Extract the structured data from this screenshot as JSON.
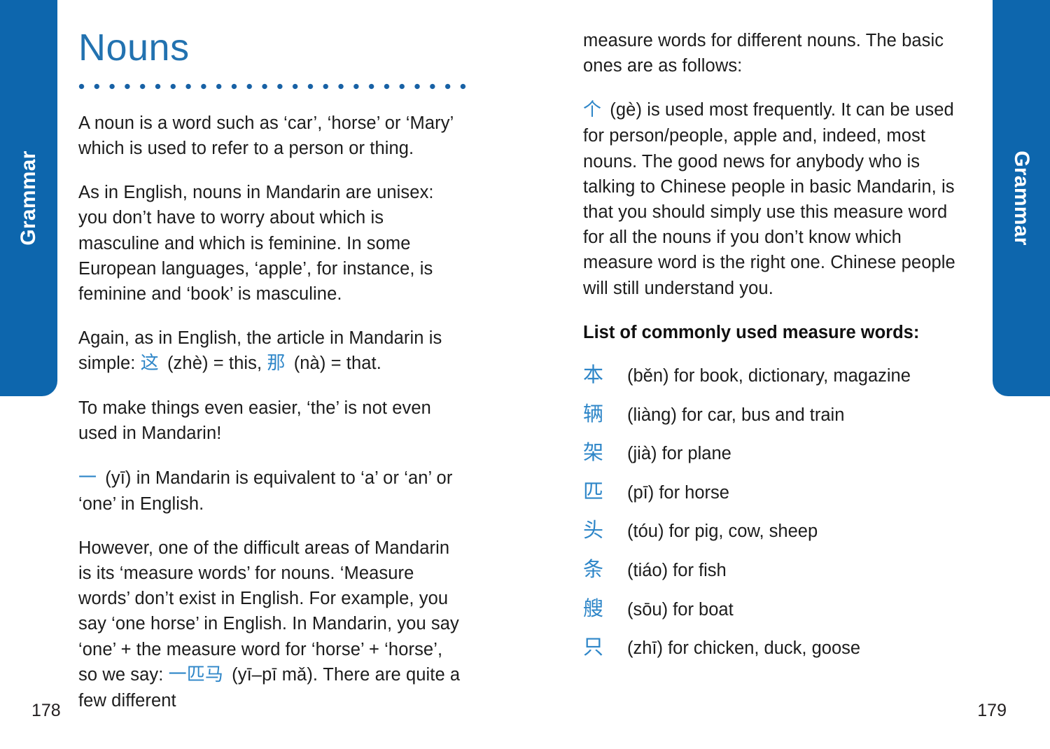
{
  "tabs": {
    "left_label": "Grammar",
    "right_label": "Grammar"
  },
  "colors": {
    "tab_blue": "#0d66ad",
    "heading_blue": "#2272b0",
    "hanzi_blue": "#2e86c8",
    "dot_blue": "#1761a5",
    "body_text": "#1c1c1c"
  },
  "left_page": {
    "heading": "Nouns",
    "folio": "178",
    "paragraphs": {
      "p1": "A noun is a word such as ‘car’, ‘horse’ or ‘Mary’ which is used to refer to a person or thing.",
      "p2": "As in English, nouns in Mandarin are unisex: you don’t have to worry about which is masculine and which is feminine. In some European languages, ‘apple’, for instance, is feminine and ‘book’ is masculine.",
      "p3_a": "Again, as in English, the article in Mandarin is simple:",
      "p3_hanzi_1": "这",
      "p3_b": "(zhè) = this,",
      "p3_hanzi_2": "那",
      "p3_c": "(nà) = that.",
      "p4": "To make things even easier, ‘the’ is not even used in Mandarin!",
      "p5_hanzi": "一",
      "p5_text": "(yī) in Mandarin is equivalent to ‘a’ or ‘an’ or ‘one’ in English.",
      "p6_a": "However, one of the difficult areas of Mandarin is its ‘measure words’ for nouns. ‘Measure words’ don’t exist in English. For example, you say ‘one horse’ in English. In Mandarin, you say ‘one’ + the measure word for ‘horse’ + ‘horse’, so we say:",
      "p6_hanzi": "一匹马",
      "p6_b": "(yī–pī mǎ). There are quite a few different"
    }
  },
  "right_page": {
    "folio": "179",
    "paragraphs": {
      "p1": "measure words for different nouns. The basic ones are as follows:",
      "p2_hanzi": "个",
      "p2_text": "(gè) is used most frequently. It can be used for person/people, apple and, indeed, most nouns. The good news for anybody who is talking to Chinese people in basic Mandarin, is that you should simply use this measure word for all the nouns if you don’t know which measure word is the right one. Chinese people will still understand you."
    },
    "subheading": "List of commonly used measure words:",
    "measure_words": [
      {
        "char": "本",
        "definition": "(běn) for book, dictionary, magazine"
      },
      {
        "char": "辆",
        "definition": "(liàng) for car, bus and train"
      },
      {
        "char": "架",
        "definition": "(jià) for plane"
      },
      {
        "char": "匹",
        "definition": "(pī) for horse"
      },
      {
        "char": "头",
        "definition": "(tóu) for pig, cow, sheep"
      },
      {
        "char": "条",
        "definition": "(tiáo) for fish"
      },
      {
        "char": "艘",
        "definition": "(sōu) for boat"
      },
      {
        "char": "只",
        "definition": "(zhī) for chicken, duck, goose"
      }
    ]
  }
}
